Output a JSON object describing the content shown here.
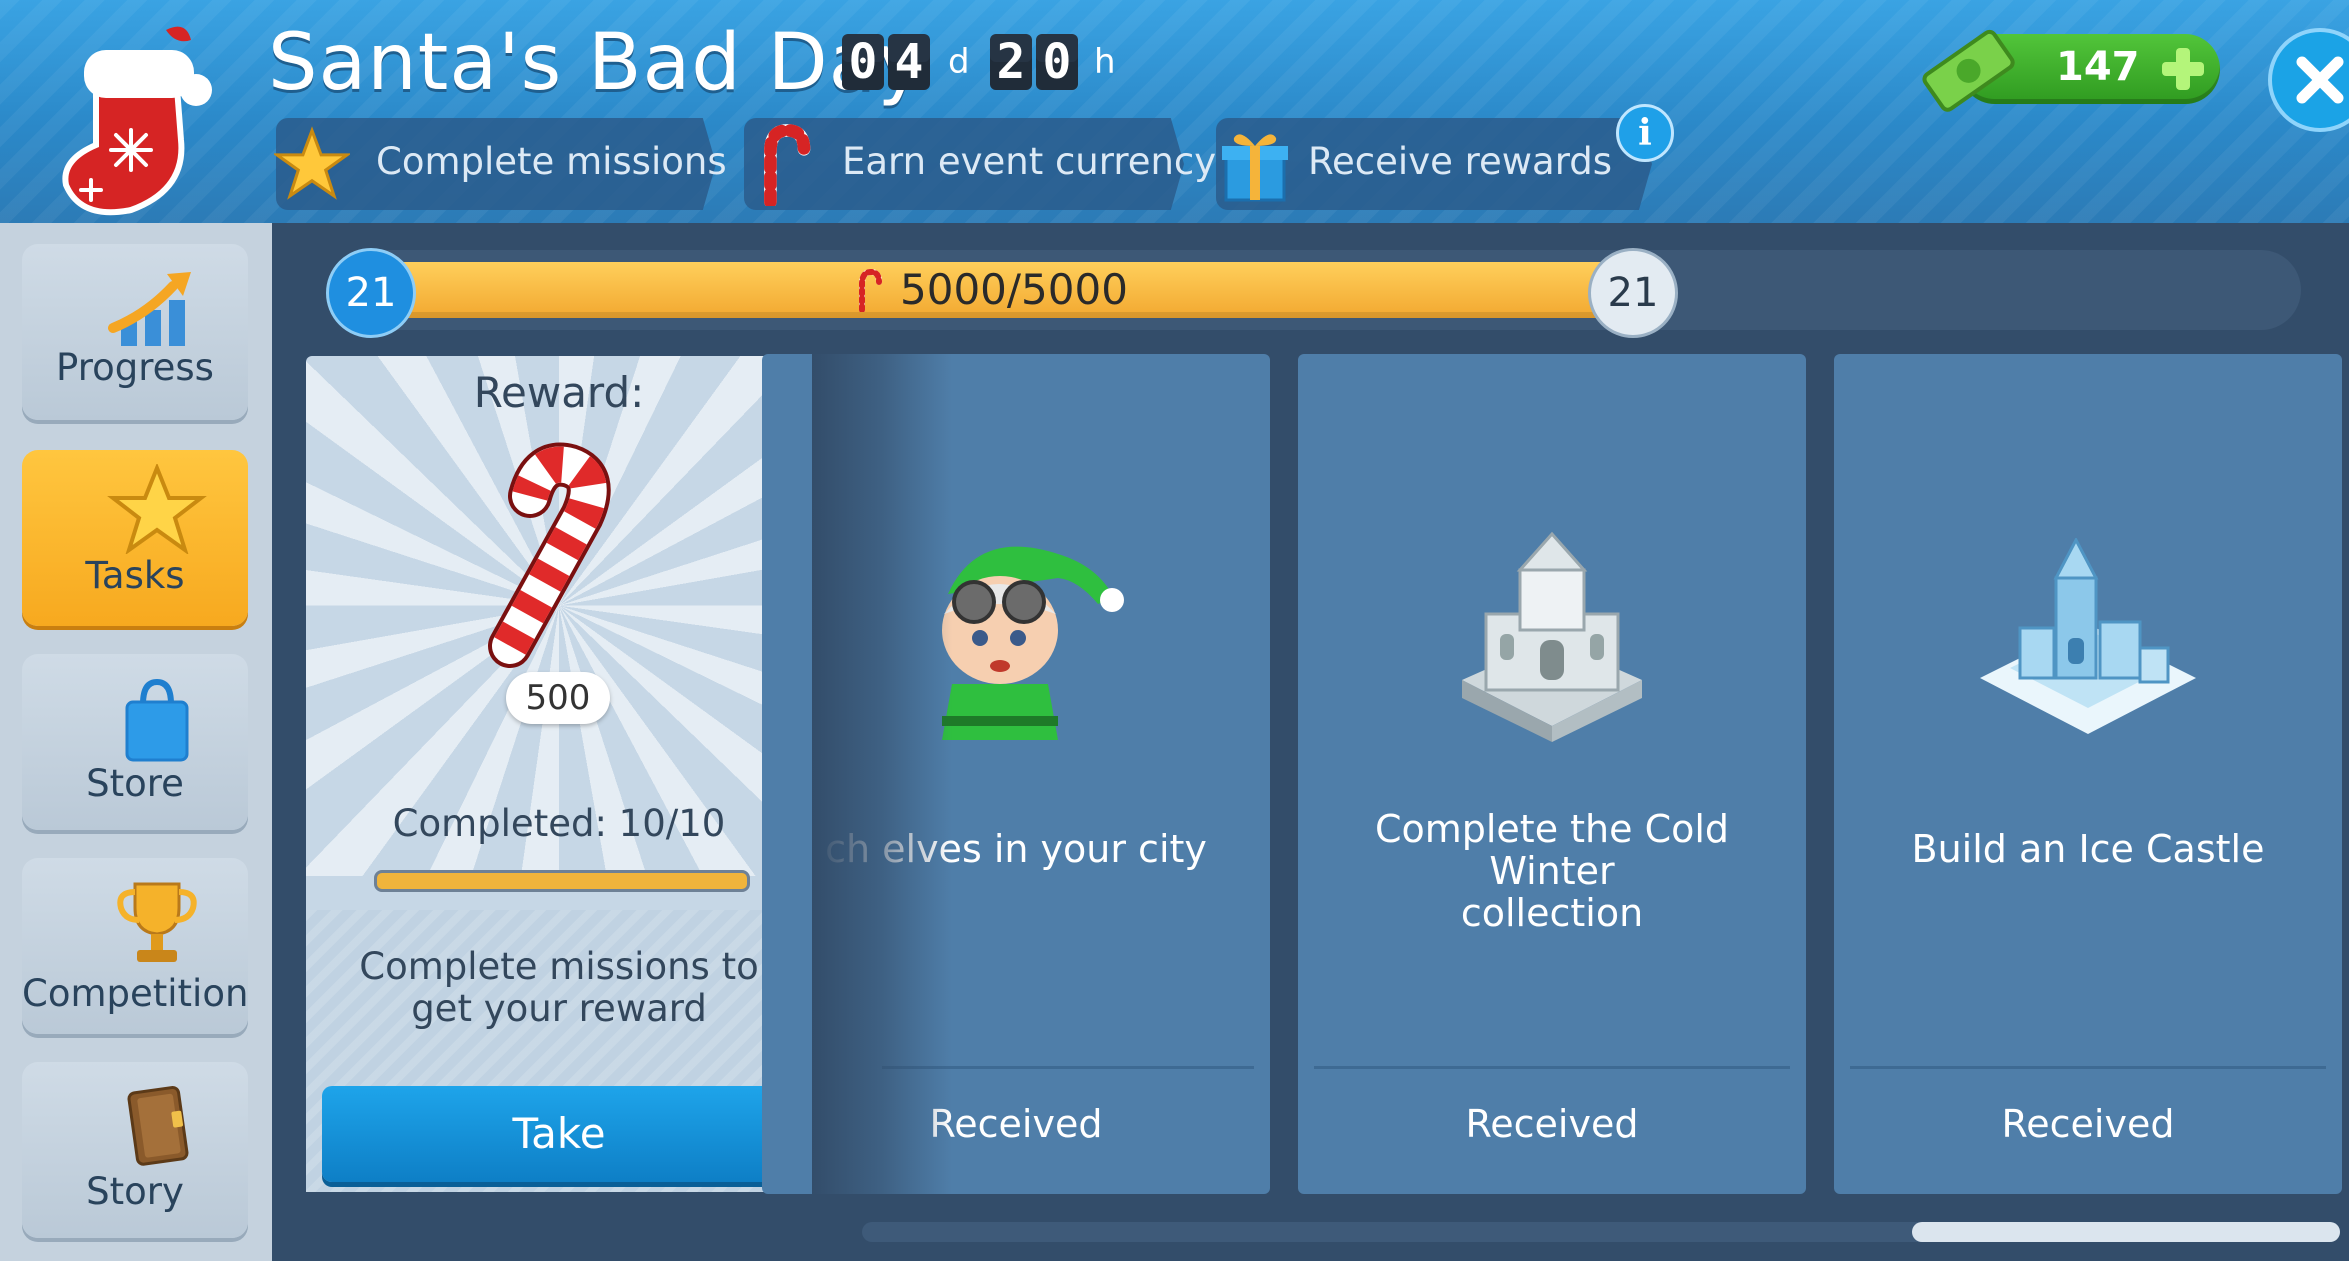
{
  "event": {
    "title": "Santa's Bad Day",
    "timer": {
      "d1": "0",
      "d2": "4",
      "day_unit": "d",
      "h1": "2",
      "h2": "0",
      "hour_unit": "h"
    }
  },
  "steps": [
    {
      "label": "Complete missions",
      "icon": "star-icon"
    },
    {
      "label": "Earn event currency",
      "icon": "candy-cane-icon"
    },
    {
      "label": "Receive rewards",
      "icon": "gift-icon"
    }
  ],
  "currency": {
    "value": "147",
    "icon": "cash-icon"
  },
  "sidebar": {
    "items": [
      {
        "label": "Progress",
        "icon": "progress-chart-icon",
        "active": false
      },
      {
        "label": "Tasks",
        "icon": "star-icon",
        "active": true
      },
      {
        "label": "Store",
        "icon": "shopping-bag-icon",
        "active": false
      },
      {
        "label": "Competition",
        "icon": "trophy-icon",
        "active": false
      },
      {
        "label": "Story",
        "icon": "book-icon",
        "active": false
      }
    ]
  },
  "progress": {
    "level_current": "21",
    "level_next": "21",
    "text": "5000/5000",
    "fraction": 1.0
  },
  "reward_card": {
    "title": "Reward:",
    "amount": "500",
    "completed": "Completed: 10/10",
    "completed_fraction": 1.0,
    "description": "Complete missions to get your reward",
    "button": "Take"
  },
  "tasks": [
    {
      "title": "ch elves in your city",
      "status": "Received",
      "icon": "elf-icon"
    },
    {
      "title": "Complete the Cold Winter\ncollection",
      "status": "Received",
      "icon": "ice-tower-icon"
    },
    {
      "title": "Build an Ice Castle",
      "status": "Received",
      "icon": "ice-castle-icon"
    }
  ],
  "colors": {
    "accent_orange": "#f7a91f",
    "accent_blue": "#1ea4ea",
    "currency_green": "#3fae2a",
    "card_blue": "#4f7ea9"
  }
}
